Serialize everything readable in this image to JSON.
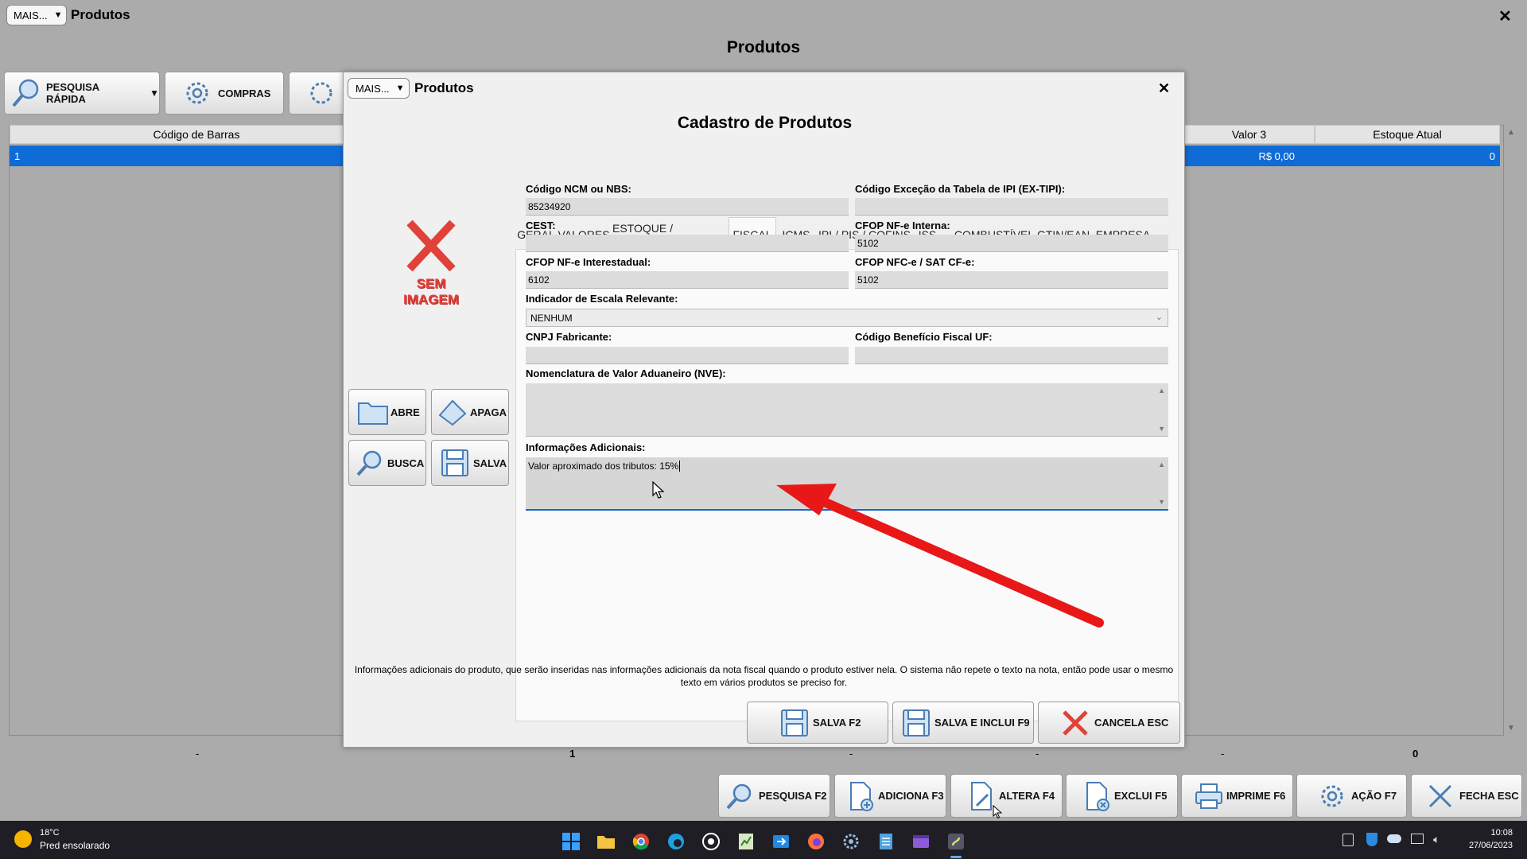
{
  "main": {
    "mais_label": "MAIS...",
    "window_title": "Produtos",
    "page_heading": "Produtos",
    "close": "✕",
    "toolbar": {
      "pesquisa_rapida": "PESQUISA RÁPIDA",
      "compras": "COMPRAS"
    },
    "table": {
      "headers": {
        "codigo_barras": "Código de Barras",
        "valor3": "Valor 3",
        "estoque_atual": "Estoque Atual"
      },
      "row": {
        "codigo_barras": "1",
        "valor3": "R$ 0,00",
        "estoque_atual": "0"
      }
    },
    "footer": {
      "c1": "-",
      "c2": "1",
      "c3": "-",
      "c4": "-",
      "c5": "-",
      "c6": "0"
    },
    "bottom_buttons": {
      "pesquisa": "PESQUISA F2",
      "adiciona": "ADICIONA F3",
      "altera": "ALTERA F4",
      "exclui": "EXCLUI F5",
      "imprime": "IMPRIME F6",
      "acao": "AÇÃO F7",
      "fecha": "FECHA ESC"
    }
  },
  "dialog": {
    "mais_label": "MAIS...",
    "title": "Produtos",
    "heading": "Cadastro de Produtos",
    "close": "✕",
    "no_image_line1": "SEM",
    "no_image_line2": "IMAGEM",
    "image_buttons": {
      "abre": "ABRE",
      "apaga": "APAGA",
      "busca": "BUSCA",
      "salva": "SALVA"
    },
    "tabs": [
      "GERAL",
      "VALORES",
      "ESTOQUE / NEGÓCIO",
      "FISCAL",
      "ICMS",
      "IPI / PIS / COFINS",
      "ISS",
      "COMBUSTÍVEL",
      "GTIN/EAN",
      "EMPRESA"
    ],
    "active_tab": "FISCAL",
    "fields": {
      "ncm_label": "Código NCM ou NBS:",
      "ncm_value": "85234920",
      "ex_tipi_label": "Código Exceção da Tabela de IPI (EX-TIPI):",
      "ex_tipi_value": "",
      "cest_label": "CEST:",
      "cest_value": "",
      "cfop_interna_label": "CFOP NF-e Interna:",
      "cfop_interna_value": "5102",
      "cfop_interestadual_label": "CFOP NF-e Interestadual:",
      "cfop_interestadual_value": "6102",
      "cfop_nfce_label": "CFOP NFC-e / SAT CF-e:",
      "cfop_nfce_value": "5102",
      "escala_label": "Indicador de Escala Relevante:",
      "escala_value": "NENHUM",
      "cnpj_label": "CNPJ Fabricante:",
      "cnpj_value": "",
      "beneficio_label": "Código Benefício Fiscal UF:",
      "beneficio_value": "",
      "nve_label": "Nomenclatura de Valor Aduaneiro (NVE):",
      "nve_value": "",
      "info_label": "Informações Adicionais:",
      "info_value": "Valor aproximado dos tributos: 15%"
    },
    "help_text": "Informações adicionais do produto, que serão inseridas nas informações adicionais da nota fiscal quando o produto estiver nela. O sistema não repete o texto na nota, então pode usar o mesmo texto em vários produtos se preciso for.",
    "buttons": {
      "salva": "SALVA F2",
      "salva_inclui": "SALVA E INCLUI F9",
      "cancela": "CANCELA ESC"
    }
  },
  "annotation_color": "#e81818",
  "taskbar": {
    "weather_temp": "18°C",
    "weather_desc": "Pred ensolarado",
    "time": "10:08",
    "date": "27/06/2023"
  }
}
